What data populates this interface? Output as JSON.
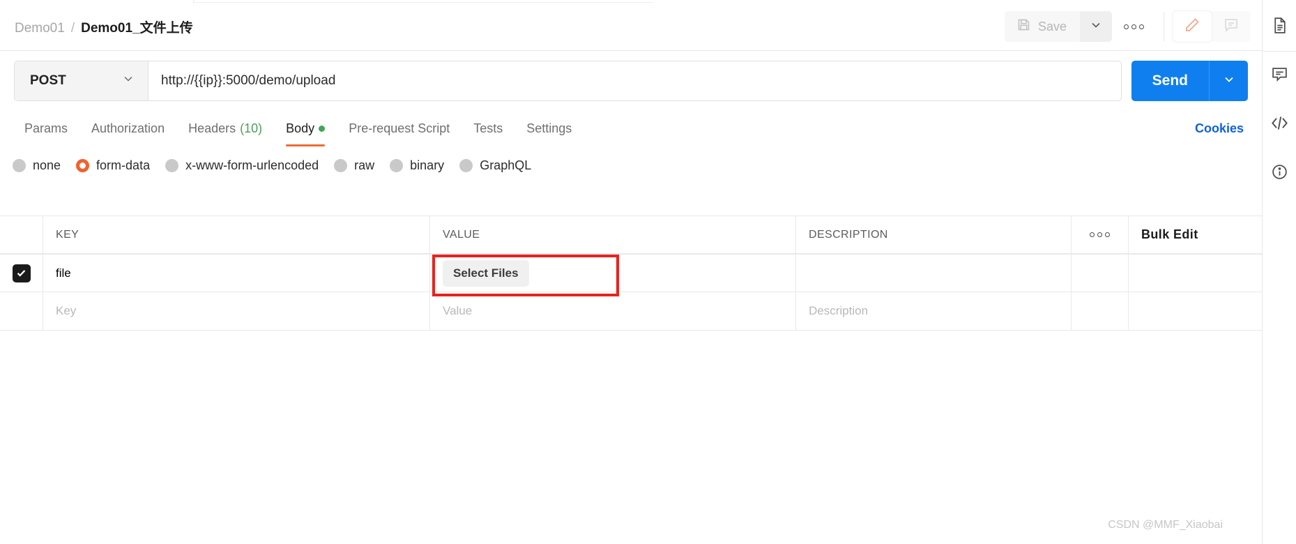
{
  "header": {
    "breadcrumb_parent": "Demo01",
    "breadcrumb_separator": "/",
    "breadcrumb_current": "Demo01_文件上传",
    "save_label": "Save",
    "save_caret_icon": "chevron-down-icon",
    "more_icon": "ellipsis-icon",
    "edit_icon": "pencil-icon",
    "comment_icon": "comment-icon"
  },
  "request": {
    "method": "POST",
    "method_caret_icon": "chevron-down-icon",
    "url": "http://{{ip}}:5000/demo/upload",
    "send_label": "Send",
    "send_caret_icon": "chevron-down-icon"
  },
  "tabs": [
    {
      "label": "Params",
      "count": "",
      "active": false,
      "dot": false
    },
    {
      "label": "Authorization",
      "count": "",
      "active": false,
      "dot": false
    },
    {
      "label": "Headers",
      "count": "(10)",
      "active": false,
      "dot": false
    },
    {
      "label": "Body",
      "count": "",
      "active": true,
      "dot": true
    },
    {
      "label": "Pre-request Script",
      "count": "",
      "active": false,
      "dot": false
    },
    {
      "label": "Tests",
      "count": "",
      "active": false,
      "dot": false
    },
    {
      "label": "Settings",
      "count": "",
      "active": false,
      "dot": false
    }
  ],
  "cookies_label": "Cookies",
  "body_types": [
    {
      "label": "none",
      "selected": false
    },
    {
      "label": "form-data",
      "selected": true
    },
    {
      "label": "x-www-form-urlencoded",
      "selected": false
    },
    {
      "label": "raw",
      "selected": false
    },
    {
      "label": "binary",
      "selected": false
    },
    {
      "label": "GraphQL",
      "selected": false
    }
  ],
  "table": {
    "columns": {
      "key": "KEY",
      "value": "VALUE",
      "description": "DESCRIPTION"
    },
    "more_icon": "ellipsis-icon",
    "bulk_edit_label": "Bulk Edit",
    "rows": [
      {
        "checked": true,
        "key": "file",
        "value_button": "Select Files",
        "description": ""
      }
    ],
    "empty_row": {
      "key_placeholder": "Key",
      "value_placeholder": "Value",
      "description_placeholder": "Description"
    }
  },
  "right_rail": [
    {
      "icon": "document-icon"
    },
    {
      "icon": "comment-icon"
    },
    {
      "icon": "code-icon",
      "glyph": "</>"
    },
    {
      "icon": "info-icon"
    }
  ],
  "watermark": "CSDN @MMF_Xiaobai",
  "colors": {
    "accent_orange": "#f0622c",
    "send_blue": "#0f7ff0",
    "link_blue": "#0f62e0",
    "annotation_red": "#e8231e",
    "status_green": "#3ea855"
  }
}
